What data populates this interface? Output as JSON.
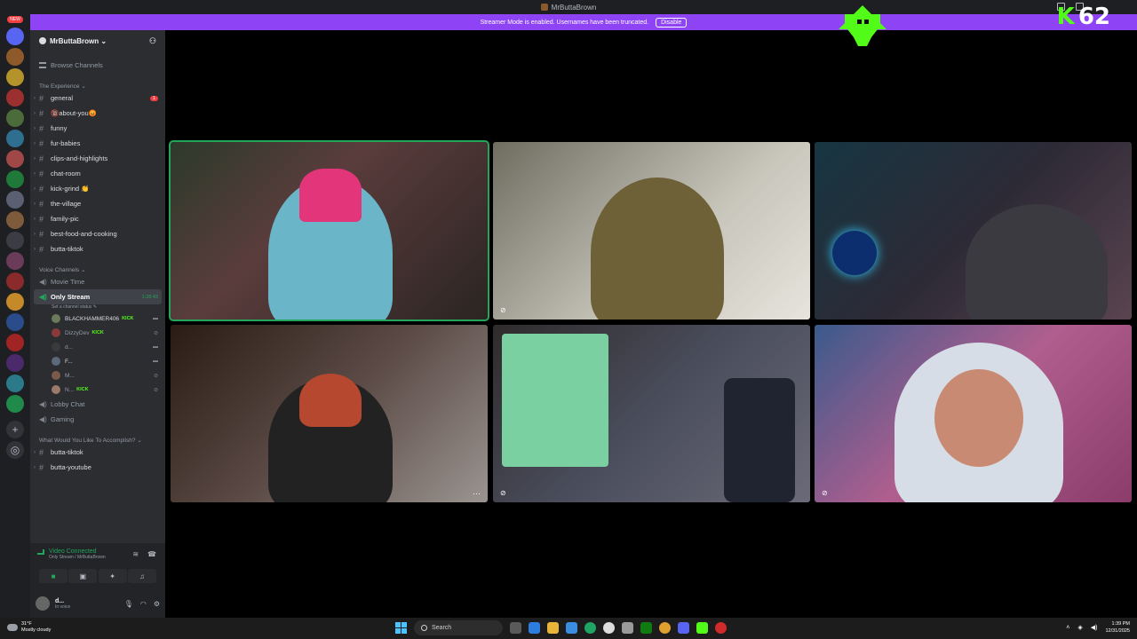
{
  "window": {
    "title": "MrButtaBrown"
  },
  "banner": {
    "text": "Streamer Mode is enabled. Usernames have been truncated.",
    "button": "Disable"
  },
  "overlay": {
    "viewer_count": "62",
    "brand_color": "#53fc18"
  },
  "rail": {
    "new_badge": "NEW"
  },
  "guild": {
    "name": "MrButtaBrown ⌄",
    "browse": "Browse Channels"
  },
  "categories": {
    "experience": "The Experience ⌄",
    "voice": "Voice Channels ⌄",
    "accomplish": "What Would You Like To Accomplish? ⌄"
  },
  "text_channels": [
    {
      "name": "general",
      "unread": "1"
    },
    {
      "name": "🔞about-you😡"
    },
    {
      "name": "funny"
    },
    {
      "name": "fur-babies"
    },
    {
      "name": "clips-and-highlights"
    },
    {
      "name": "chat-room"
    },
    {
      "name": "kick-grind 👏"
    },
    {
      "name": "the-village"
    },
    {
      "name": "family-pic"
    },
    {
      "name": "best-food-and-cooking"
    },
    {
      "name": "butta-tiktok"
    }
  ],
  "voice_channels": {
    "movie_time": "Movie Time",
    "only_stream": "Only Stream",
    "only_stream_timer": "1:28:43",
    "only_stream_status": "Set a channel status ✎",
    "lobby_chat": "Lobby Chat",
    "gaming": "Gaming"
  },
  "members": [
    {
      "name": "BLACKHAMMER406",
      "badge": "KICK"
    },
    {
      "name": "DizzyDev",
      "badge": "KICK"
    },
    {
      "name": "d..."
    },
    {
      "name": "F..."
    },
    {
      "name": "M..."
    },
    {
      "name": "N...",
      "badge": "KICK"
    }
  ],
  "accomplish_channels": [
    {
      "name": "butta-tiktok"
    },
    {
      "name": "butta-youtube"
    }
  ],
  "voice_panel": {
    "status": "Video Connected",
    "location": "Only Stream / MrButtaBrown"
  },
  "user_panel": {
    "name": "d...",
    "status": "In voice"
  },
  "taskbar": {
    "weather_temp": "31°F",
    "weather_desc": "Mostly cloudy",
    "search_label": "Search",
    "time": "1:39 PM",
    "date": "12/31/2025"
  },
  "icons": [
    "discord-icon",
    "add-user-icon",
    "hash-icon",
    "speaker-icon",
    "mic-off-icon",
    "more-icon",
    "camera-icon",
    "screen-share-icon",
    "activity-icon",
    "soundboard-icon",
    "mic-icon",
    "headphones-icon",
    "gear-icon",
    "windows-icon",
    "search-icon"
  ]
}
